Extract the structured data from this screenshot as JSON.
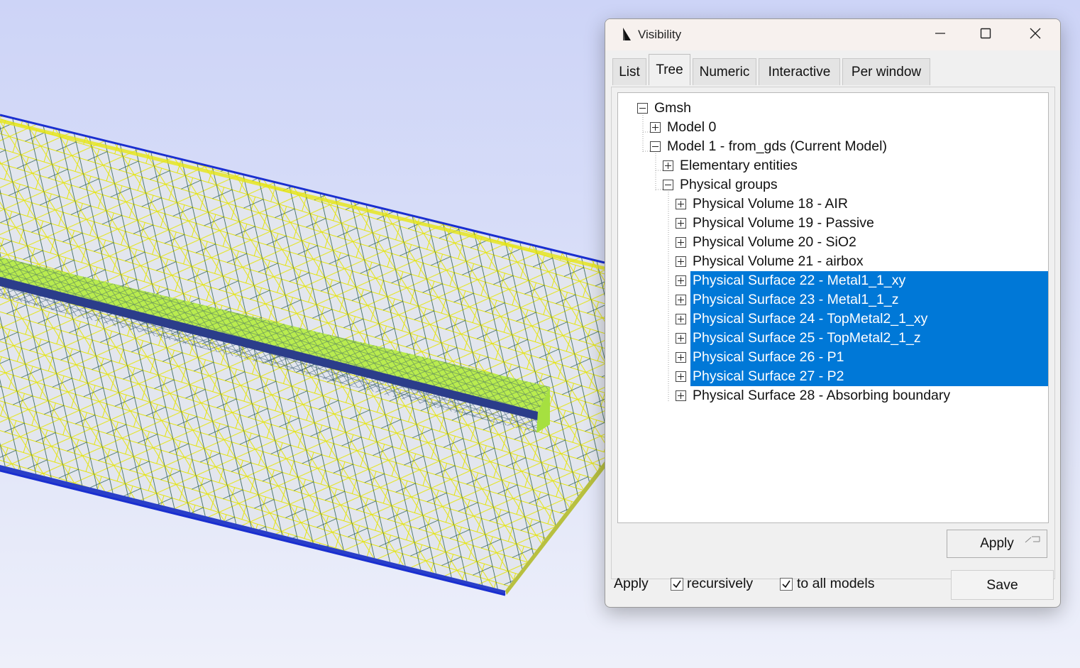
{
  "window": {
    "title": "Visibility",
    "icons": {
      "app": "gmsh-icon",
      "minimize": "minimize-icon",
      "maximize": "maximize-icon",
      "close": "close-icon"
    }
  },
  "tabs": [
    {
      "label": "List",
      "active": false
    },
    {
      "label": "Tree",
      "active": true
    },
    {
      "label": "Numeric",
      "active": false
    },
    {
      "label": "Interactive",
      "active": false
    },
    {
      "label": "Per window",
      "active": false
    }
  ],
  "tree": {
    "rows": [
      {
        "label": "Gmsh",
        "expanded": true,
        "selected": false
      },
      {
        "label": "Model 0",
        "expanded": false,
        "selected": false
      },
      {
        "label": "Model 1 - from_gds (Current Model)",
        "expanded": true,
        "selected": false
      },
      {
        "label": "Elementary entities",
        "expanded": false,
        "selected": false
      },
      {
        "label": "Physical groups",
        "expanded": true,
        "selected": false
      },
      {
        "label": "Physical Volume 18 - AIR",
        "expanded": false,
        "selected": false
      },
      {
        "label": "Physical Volume 19 - Passive",
        "expanded": false,
        "selected": false
      },
      {
        "label": "Physical Volume 20 - SiO2",
        "expanded": false,
        "selected": false
      },
      {
        "label": "Physical Volume 21 - airbox",
        "expanded": false,
        "selected": false
      },
      {
        "label": "Physical Surface 22 - Metal1_1_xy",
        "expanded": false,
        "selected": true
      },
      {
        "label": "Physical Surface 23 - Metal1_1_z",
        "expanded": false,
        "selected": true
      },
      {
        "label": "Physical Surface 24 - TopMetal2_1_xy",
        "expanded": false,
        "selected": true
      },
      {
        "label": "Physical Surface 25 - TopMetal2_1_z",
        "expanded": false,
        "selected": true
      },
      {
        "label": "Physical Surface 26 - P1",
        "expanded": false,
        "selected": true
      },
      {
        "label": "Physical Surface 27 - P2",
        "expanded": false,
        "selected": true
      },
      {
        "label": "Physical Surface 28 - Absorbing boundary",
        "expanded": false,
        "selected": false
      }
    ]
  },
  "buttons": {
    "apply": "Apply",
    "save": "Save"
  },
  "options": {
    "apply_label": "Apply",
    "recursively": {
      "label": "recursively",
      "checked": true
    },
    "all_models": {
      "label": "to all models",
      "checked": true
    }
  },
  "colors": {
    "selection": "#0078d7",
    "mesh_lines": "#f2f20a",
    "mesh_edges": "#1a5a4a",
    "boundary": "#1a2fd0",
    "background_top": "#cdd4f7"
  }
}
